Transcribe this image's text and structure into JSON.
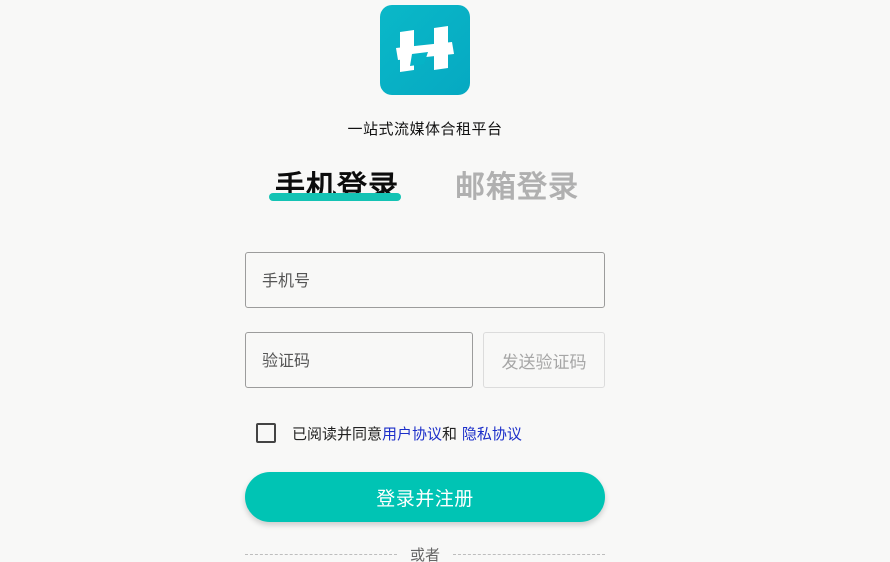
{
  "brand": {
    "logo_icon": "h-letter-logo-icon",
    "accent_color": "#00c4b4",
    "logo_color": "#06b3c6",
    "tagline": "一站式流媒体合租平台"
  },
  "tabs": [
    {
      "label": "手机登录",
      "active": true
    },
    {
      "label": "邮箱登录",
      "active": false
    }
  ],
  "form": {
    "phone_placeholder": "手机号",
    "phone_value": "",
    "code_placeholder": "验证码",
    "code_value": "",
    "send_code_label": "发送验证码",
    "agree_text": "已阅读并同意",
    "user_agreement_link": "用户协议",
    "and_text": "和 ",
    "privacy_link": "隐私协议",
    "agree_checked": false,
    "submit_label": "登录并注册"
  },
  "divider": {
    "text": "或者"
  }
}
